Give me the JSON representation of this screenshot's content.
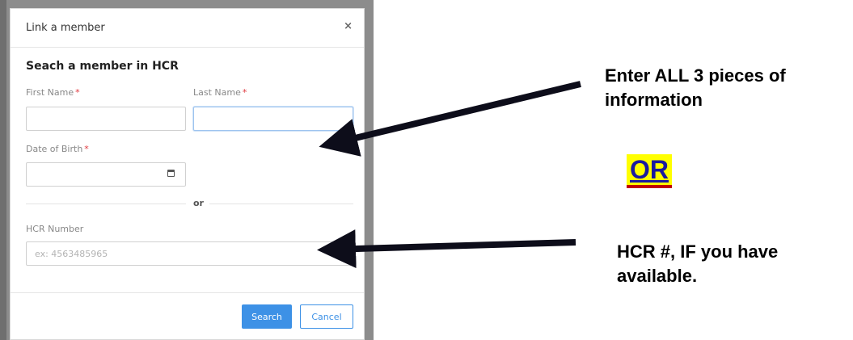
{
  "modal": {
    "title": "Link a member",
    "close_glyph": "×",
    "section_title": "Seach a member in HCR",
    "first_name_label": "First Name",
    "last_name_label": "Last Name",
    "dob_label": "Date of Birth",
    "required_mark": "*",
    "divider_text": "or",
    "hcr_label": "HCR Number",
    "hcr_placeholder": "ex: 4563485965",
    "first_name_value": "",
    "last_name_value": "",
    "dob_value": "",
    "search_button": "Search",
    "cancel_button": "Cancel"
  },
  "annotations": {
    "instruction_1": "Enter ALL 3 pieces of information",
    "or_text": "OR",
    "instruction_2": "HCR #, IF you have available."
  },
  "colors": {
    "primary": "#3d91e6",
    "required": "#e0393e",
    "or_highlight": "#ffff00",
    "or_text": "#1a1aa0",
    "arrow": "#0d0d1a"
  },
  "icons": {
    "calendar": "calendar-icon",
    "close": "close-icon"
  }
}
